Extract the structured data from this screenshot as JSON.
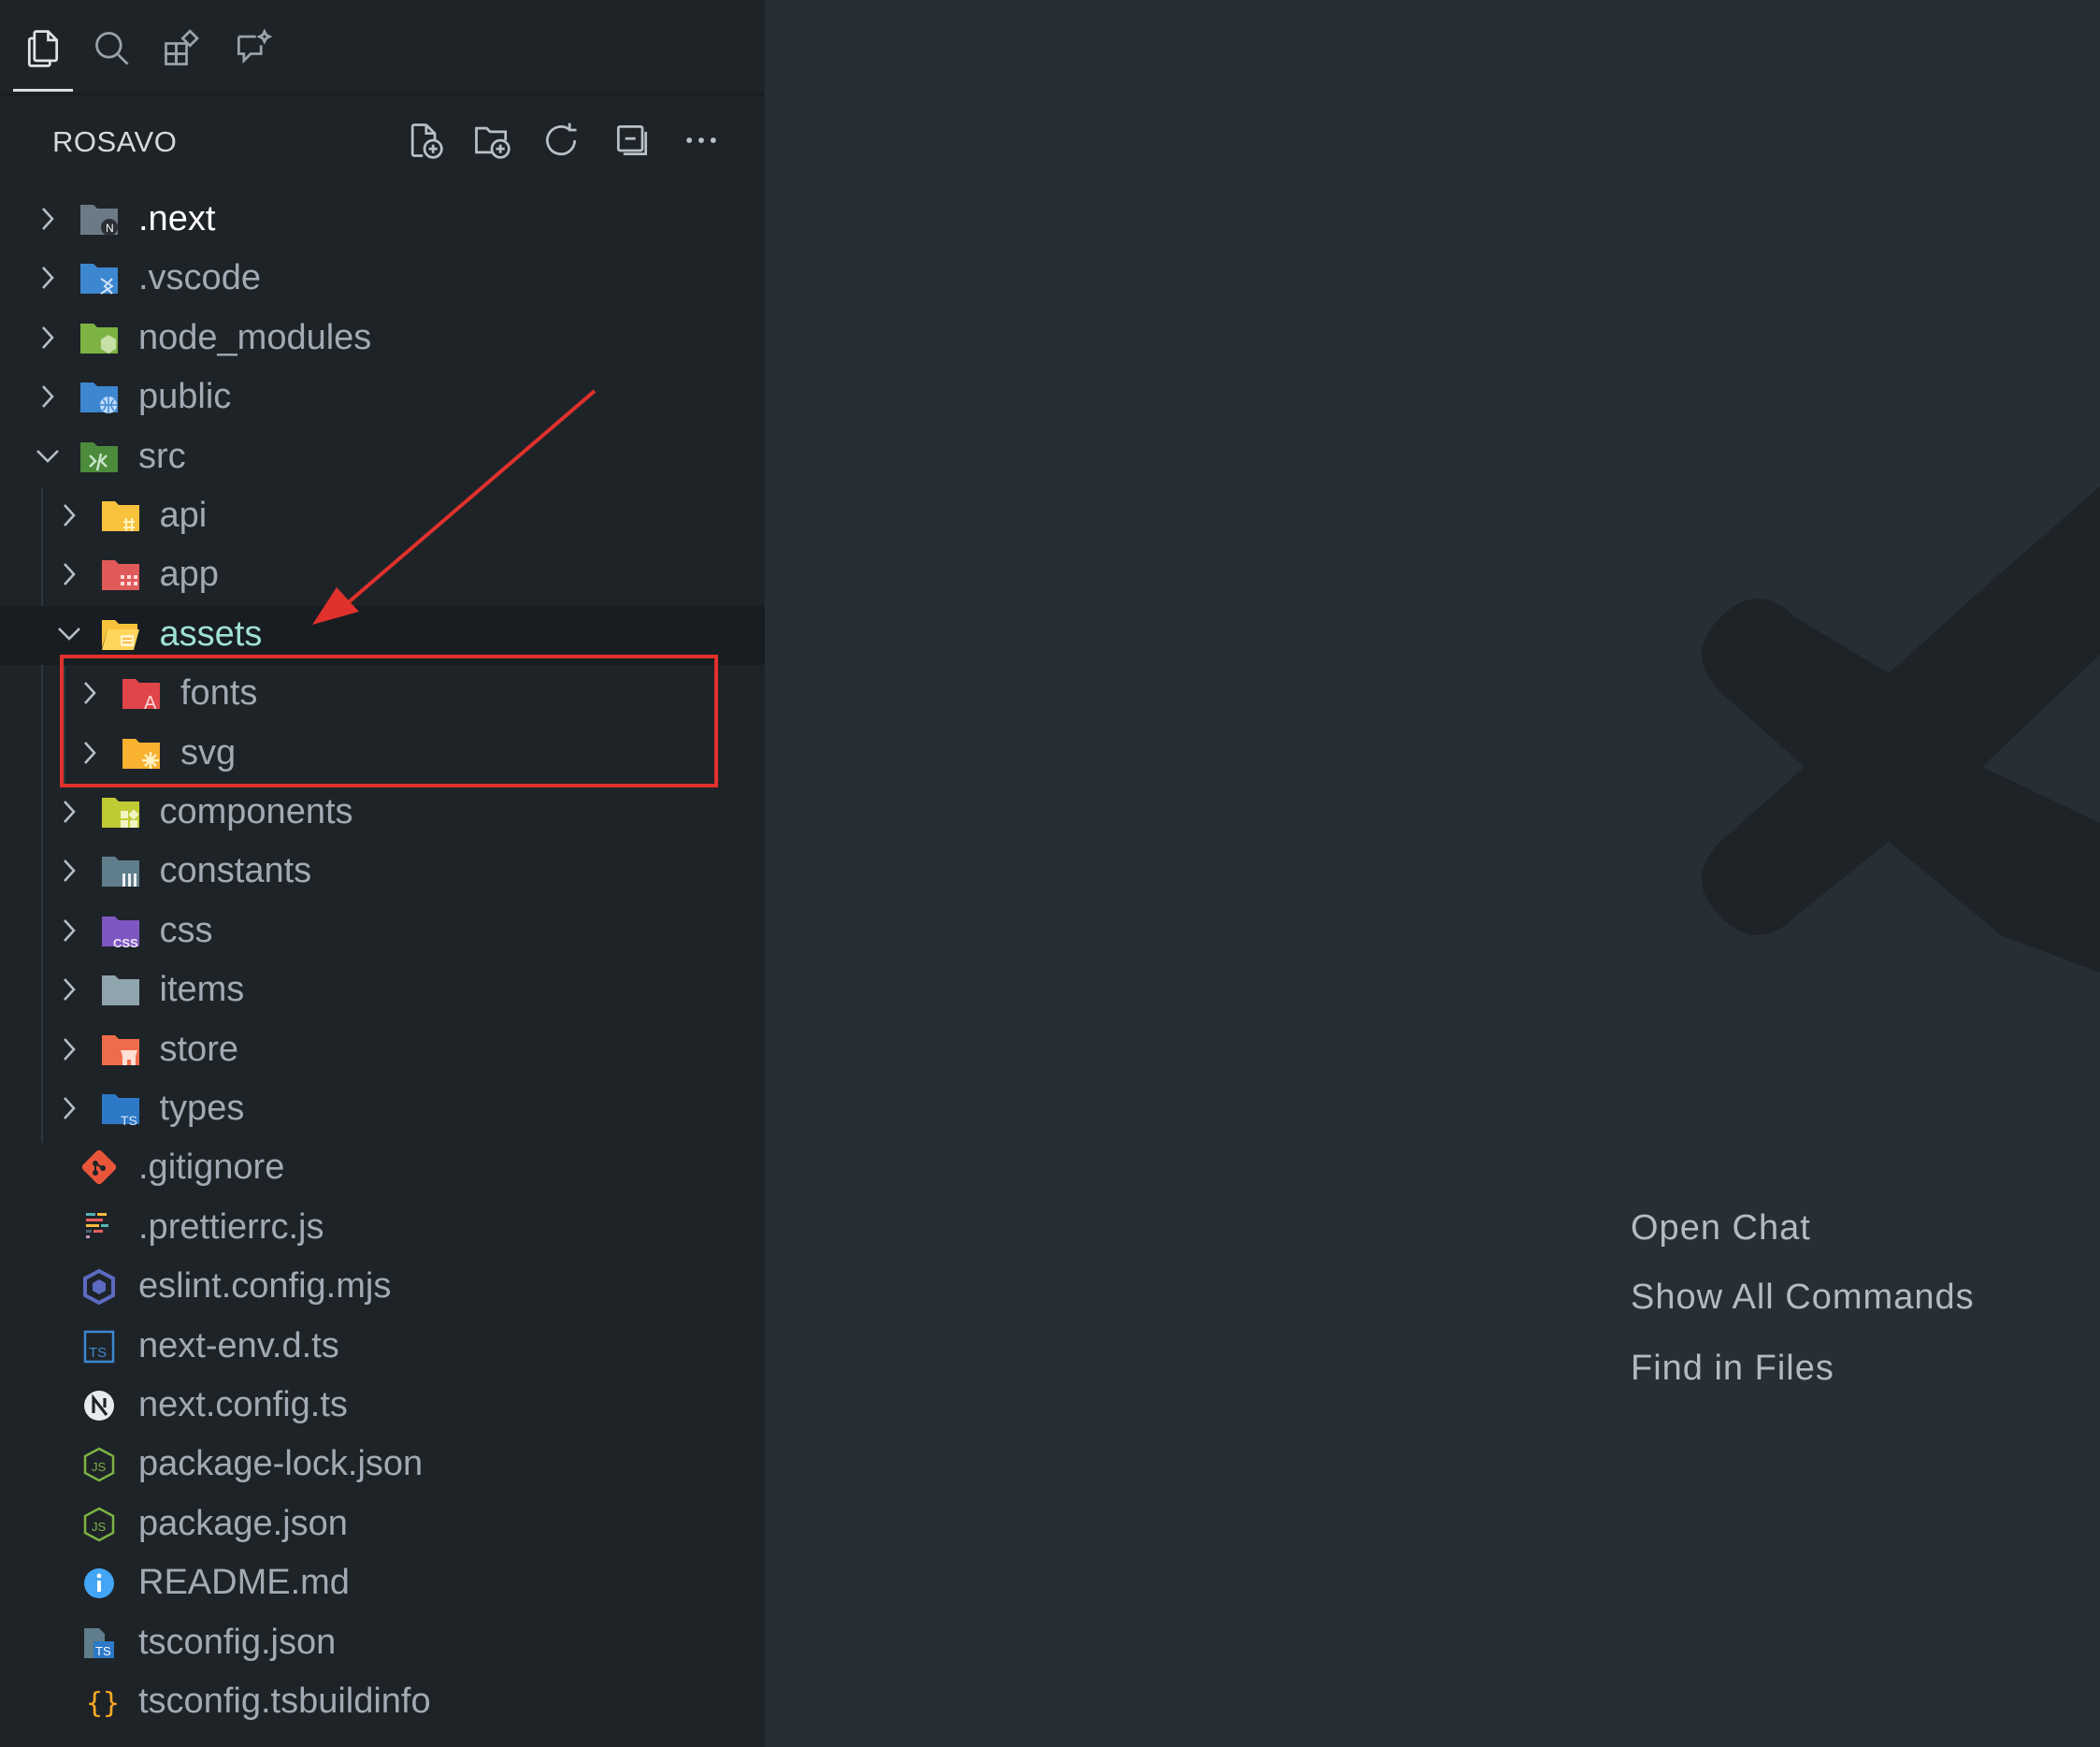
{
  "activity_bar": {
    "items": [
      {
        "name": "explorer",
        "icon": "files-icon",
        "active": true
      },
      {
        "name": "search",
        "icon": "search-icon"
      },
      {
        "name": "extensions",
        "icon": "extensions-icon"
      },
      {
        "name": "chat",
        "icon": "chat-sparkle-icon"
      }
    ]
  },
  "explorer": {
    "project_title": "ROSAVO",
    "actions": [
      "new-file-icon",
      "new-folder-icon",
      "refresh-icon",
      "collapse-all-icon",
      "more-icon"
    ]
  },
  "tree": {
    "items": [
      {
        "label": ".next",
        "type": "folder",
        "depth": 0,
        "expanded": false,
        "icon": "next-folder-icon"
      },
      {
        "label": ".vscode",
        "type": "folder",
        "depth": 0,
        "expanded": false,
        "icon": "vscode-folder-icon"
      },
      {
        "label": "node_modules",
        "type": "folder",
        "depth": 0,
        "expanded": false,
        "icon": "node-folder-icon"
      },
      {
        "label": "public",
        "type": "folder",
        "depth": 0,
        "expanded": false,
        "icon": "public-folder-icon"
      },
      {
        "label": "src",
        "type": "folder",
        "depth": 0,
        "expanded": true,
        "icon": "src-folder-icon"
      },
      {
        "label": "api",
        "type": "folder",
        "depth": 1,
        "expanded": false,
        "icon": "api-folder-icon"
      },
      {
        "label": "app",
        "type": "folder",
        "depth": 1,
        "expanded": false,
        "icon": "app-folder-icon"
      },
      {
        "label": "assets",
        "type": "folder",
        "depth": 1,
        "expanded": true,
        "icon": "assets-folder-icon",
        "selected": true
      },
      {
        "label": "fonts",
        "type": "folder",
        "depth": 2,
        "expanded": false,
        "icon": "fonts-folder-icon"
      },
      {
        "label": "svg",
        "type": "folder",
        "depth": 2,
        "expanded": false,
        "icon": "svg-folder-icon"
      },
      {
        "label": "components",
        "type": "folder",
        "depth": 1,
        "expanded": false,
        "icon": "components-folder-icon"
      },
      {
        "label": "constants",
        "type": "folder",
        "depth": 1,
        "expanded": false,
        "icon": "constants-folder-icon"
      },
      {
        "label": "css",
        "type": "folder",
        "depth": 1,
        "expanded": false,
        "icon": "css-folder-icon"
      },
      {
        "label": "items",
        "type": "folder",
        "depth": 1,
        "expanded": false,
        "icon": "folder-icon"
      },
      {
        "label": "store",
        "type": "folder",
        "depth": 1,
        "expanded": false,
        "icon": "store-folder-icon"
      },
      {
        "label": "types",
        "type": "folder",
        "depth": 1,
        "expanded": false,
        "icon": "types-folder-icon"
      },
      {
        "label": ".gitignore",
        "type": "file",
        "depth": 0,
        "icon": "git-icon"
      },
      {
        "label": ".prettierrc.js",
        "type": "file",
        "depth": 0,
        "icon": "prettier-icon"
      },
      {
        "label": "eslint.config.mjs",
        "type": "file",
        "depth": 0,
        "icon": "eslint-icon"
      },
      {
        "label": "next-env.d.ts",
        "type": "file",
        "depth": 0,
        "icon": "typescript-def-icon"
      },
      {
        "label": "next.config.ts",
        "type": "file",
        "depth": 0,
        "icon": "next-icon"
      },
      {
        "label": "package-lock.json",
        "type": "file",
        "depth": 0,
        "icon": "nodejs-icon"
      },
      {
        "label": "package.json",
        "type": "file",
        "depth": 0,
        "icon": "nodejs-icon"
      },
      {
        "label": "README.md",
        "type": "file",
        "depth": 0,
        "icon": "info-icon"
      },
      {
        "label": "tsconfig.json",
        "type": "file",
        "depth": 0,
        "icon": "tsconfig-icon"
      },
      {
        "label": "tsconfig.tsbuildinfo",
        "type": "file",
        "depth": 0,
        "icon": "json-braces-icon"
      }
    ]
  },
  "editor": {
    "watermark_icon": "cursor-x-logo-icon",
    "commands": [
      "Open Chat",
      "Show All Commands",
      "Find in Files"
    ]
  },
  "annotation": {
    "box_color": "#e0312c",
    "arrow_color": "#e0312c"
  }
}
